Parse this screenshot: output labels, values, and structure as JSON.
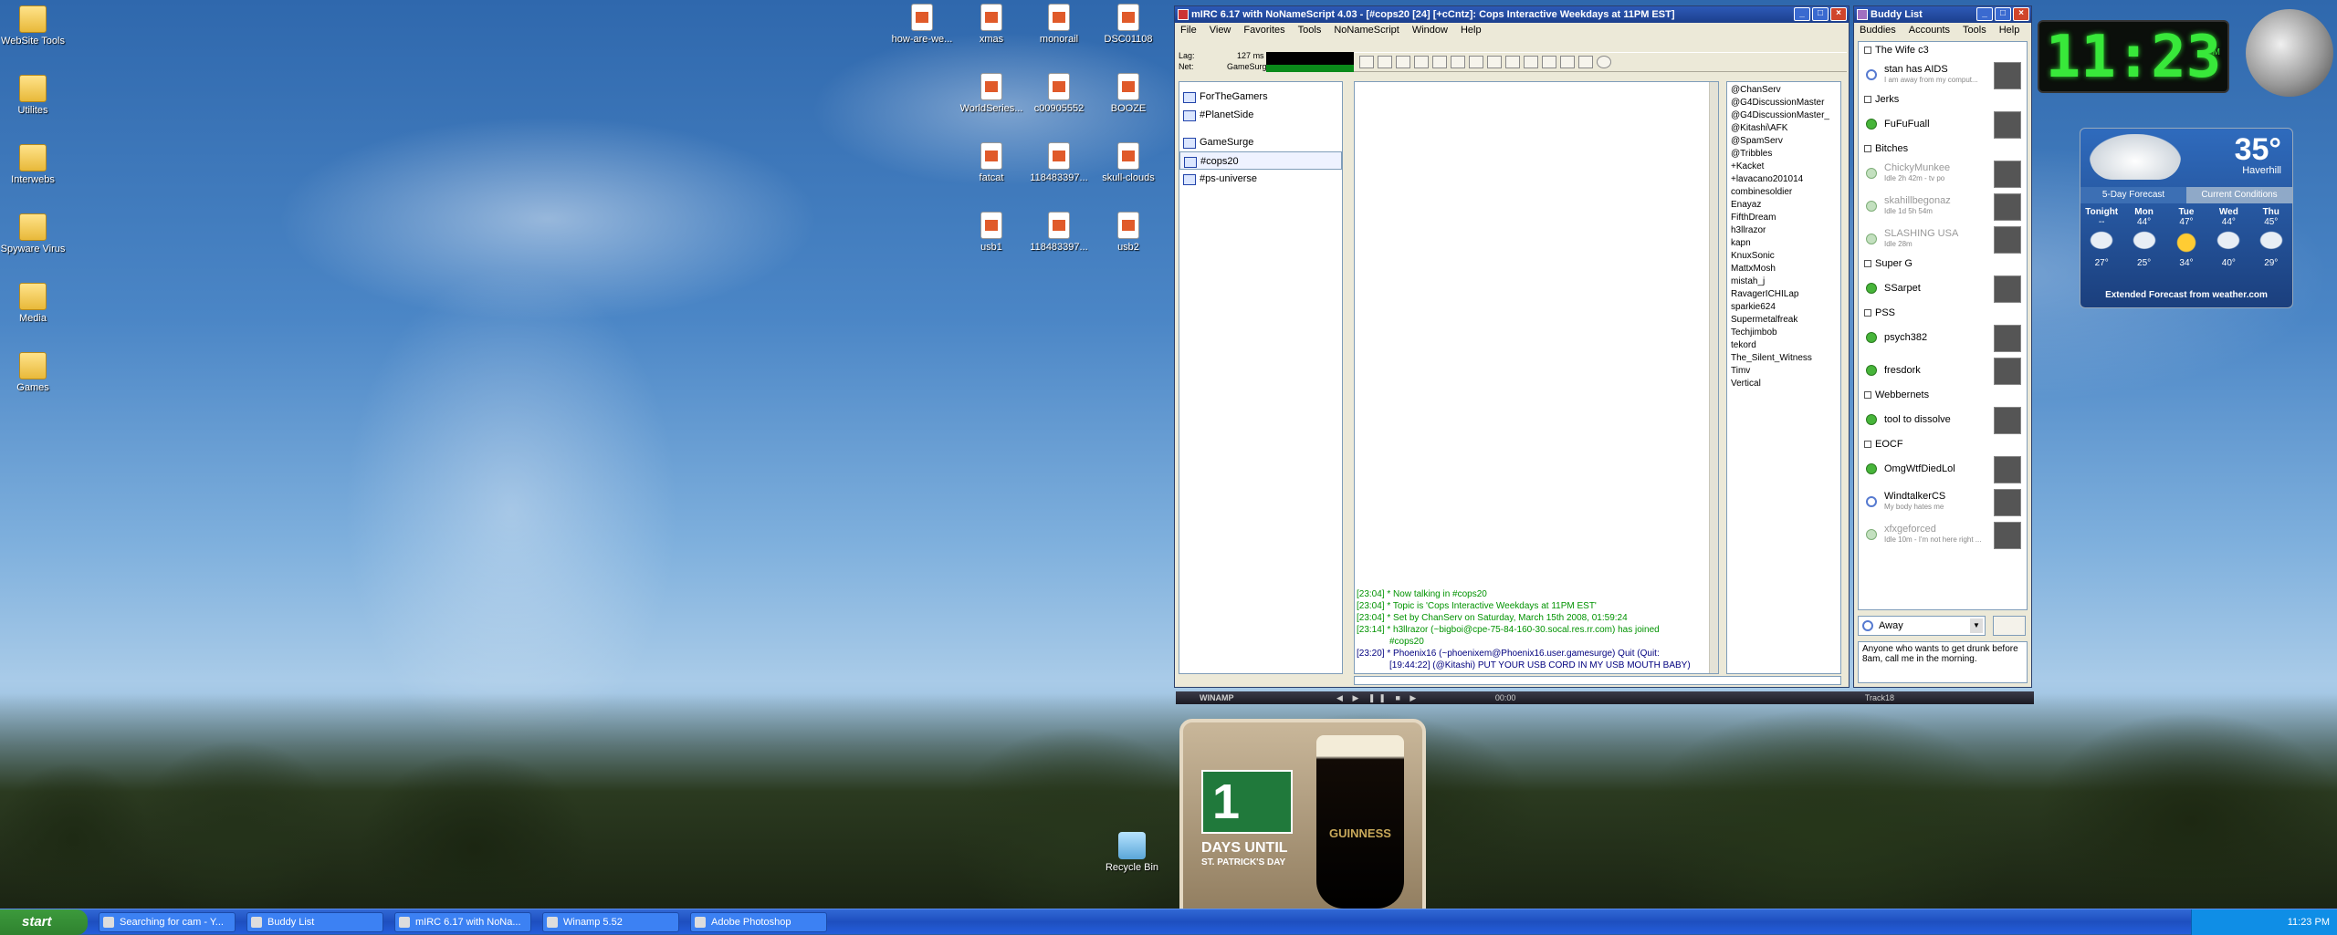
{
  "desktop_icons_left": [
    "WebSite Tools",
    "Utilites",
    "Interwebs",
    "Spyware Virus",
    "Media",
    "Games"
  ],
  "desktop_icons_grid": [
    [
      "how-are-we...",
      "xmas",
      "monorail",
      "DSC01108"
    ],
    [
      "WorldSeries...",
      "c00905552",
      "BOOZE"
    ],
    [
      "fatcat",
      "118483397...",
      "skull-clouds"
    ],
    [
      "usb1",
      "118483397...",
      "usb2"
    ]
  ],
  "recycle_bin": "Recycle Bin",
  "mirc": {
    "title": "mIRC 6.17 with NoNameScript 4.03 - [#cops20 [24] [+cCntz]: Cops Interactive Weekdays at 11PM EST]",
    "menu": [
      "File",
      "View",
      "Favorites",
      "Tools",
      "NoNameScript",
      "Window",
      "Help"
    ],
    "lag_label": "Lag:",
    "lag_value": "127 ms",
    "net_label": "Net:",
    "net_value": "GameSurge",
    "tree": [
      "ForTheGamers",
      "#PlanetSide",
      "GameSurge",
      "#cops20",
      "#ps-universe"
    ],
    "selected_channel": "#cops20",
    "chat_lines": [
      "[23:04] * Now talking in #cops20",
      "[23:04] * Topic is 'Cops Interactive Weekdays at 11PM EST'",
      "[23:04] * Set by ChanServ on Saturday, March 15th 2008, 01:59:24",
      "[23:14] * h3llrazor (~bigboi@cpe-75-84-160-30.socal.res.rr.com) has joined",
      "#cops20",
      "[23:20] * Phoenix16 (~phoenixem@Phoenix16.user.gamesurge) Quit (Quit:",
      "[19:44:22] (@Kitashi) PUT YOUR USB CORD IN MY USB MOUTH BABY)"
    ],
    "nicks": [
      "@ChanServ",
      "@G4DiscussionMaster",
      "@G4DiscussionMaster_",
      "@Kitashi\\AFK",
      "@SpamServ",
      "@Tribbles",
      "+Kacket",
      "+lavacano201014",
      "combinesoldier",
      "Enayaz",
      "FifthDream",
      "h3llrazor",
      "kapn",
      "KnuxSonic",
      "MattxMosh",
      "mistah_j",
      "RavagerICHILap",
      "sparkie624",
      "Supermetalfreak",
      "Techjimbob",
      "tekord",
      "The_Silent_Witness",
      "Timv",
      "Vertical"
    ]
  },
  "buddy": {
    "title": "Buddy List",
    "menu": [
      "Buddies",
      "Accounts",
      "Tools",
      "Help"
    ],
    "groups": [
      {
        "name": "The Wife c3",
        "buddies": [
          {
            "name": "stan has AIDS",
            "status": "away",
            "sub": "I am away from my comput..."
          }
        ]
      },
      {
        "name": "Jerks",
        "buddies": [
          {
            "name": "FuFuFuall",
            "status": "online",
            "sub": ""
          }
        ]
      },
      {
        "name": "Bitches",
        "buddies": [
          {
            "name": "ChickyMunkee",
            "status": "idle",
            "sub": "Idle 2h 42m - tv po"
          },
          {
            "name": "skahillbegonaz",
            "status": "idle",
            "sub": "Idle 1d 5h 54m"
          },
          {
            "name": "SLASHING USA",
            "status": "idle",
            "sub": "Idle 28m"
          }
        ]
      },
      {
        "name": "Super G",
        "buddies": [
          {
            "name": "SSarpet",
            "status": "online",
            "sub": ""
          }
        ]
      },
      {
        "name": "PSS",
        "buddies": [
          {
            "name": "psych382",
            "status": "online",
            "sub": ""
          },
          {
            "name": "fresdork",
            "status": "online",
            "sub": ""
          }
        ]
      },
      {
        "name": "Webbernets",
        "buddies": [
          {
            "name": "tool to dissolve",
            "status": "online",
            "sub": ""
          }
        ]
      },
      {
        "name": "EOCF",
        "buddies": [
          {
            "name": "OmgWtfDiedLol",
            "status": "online",
            "sub": ""
          },
          {
            "name": "WindtalkerCS",
            "status": "away",
            "sub": "My body hates me"
          },
          {
            "name": "xfxgeforced",
            "status": "idle",
            "sub": "Idle 10m - I'm not here right ..."
          }
        ]
      }
    ],
    "status_select": "Away",
    "status_message": "Anyone who wants to get drunk before 8am, call me in the morning."
  },
  "clock": "11:23",
  "clock_pm": "PM",
  "weather": {
    "temp": "35°",
    "city": "Haverhill",
    "tabs": [
      "5-Day Forecast",
      "Current Conditions"
    ],
    "days": [
      {
        "name": "Tonight",
        "hi": "--",
        "lo": "27°"
      },
      {
        "name": "Mon",
        "hi": "44°",
        "lo": "25°"
      },
      {
        "name": "Tue",
        "hi": "47°",
        "lo": "34°"
      },
      {
        "name": "Wed",
        "hi": "44°",
        "lo": "40°"
      },
      {
        "name": "Thu",
        "hi": "45°",
        "lo": "29°"
      }
    ],
    "footer": "Extended Forecast from weather.com"
  },
  "winamp": {
    "label": "WINAMP",
    "time": "00:00",
    "track": "Track18"
  },
  "guinness": {
    "count": "1",
    "line1": "DAYS UNTIL",
    "line2": "ST. PATRICK'S DAY",
    "brand": "GUINNESS"
  },
  "taskbar": {
    "start": "start",
    "tasks": [
      "Searching for cam - Y...",
      "Buddy List",
      "mIRC 6.17 with NoNa...",
      "Winamp 5.52",
      "Adobe Photoshop"
    ],
    "time": "11:23 PM"
  }
}
